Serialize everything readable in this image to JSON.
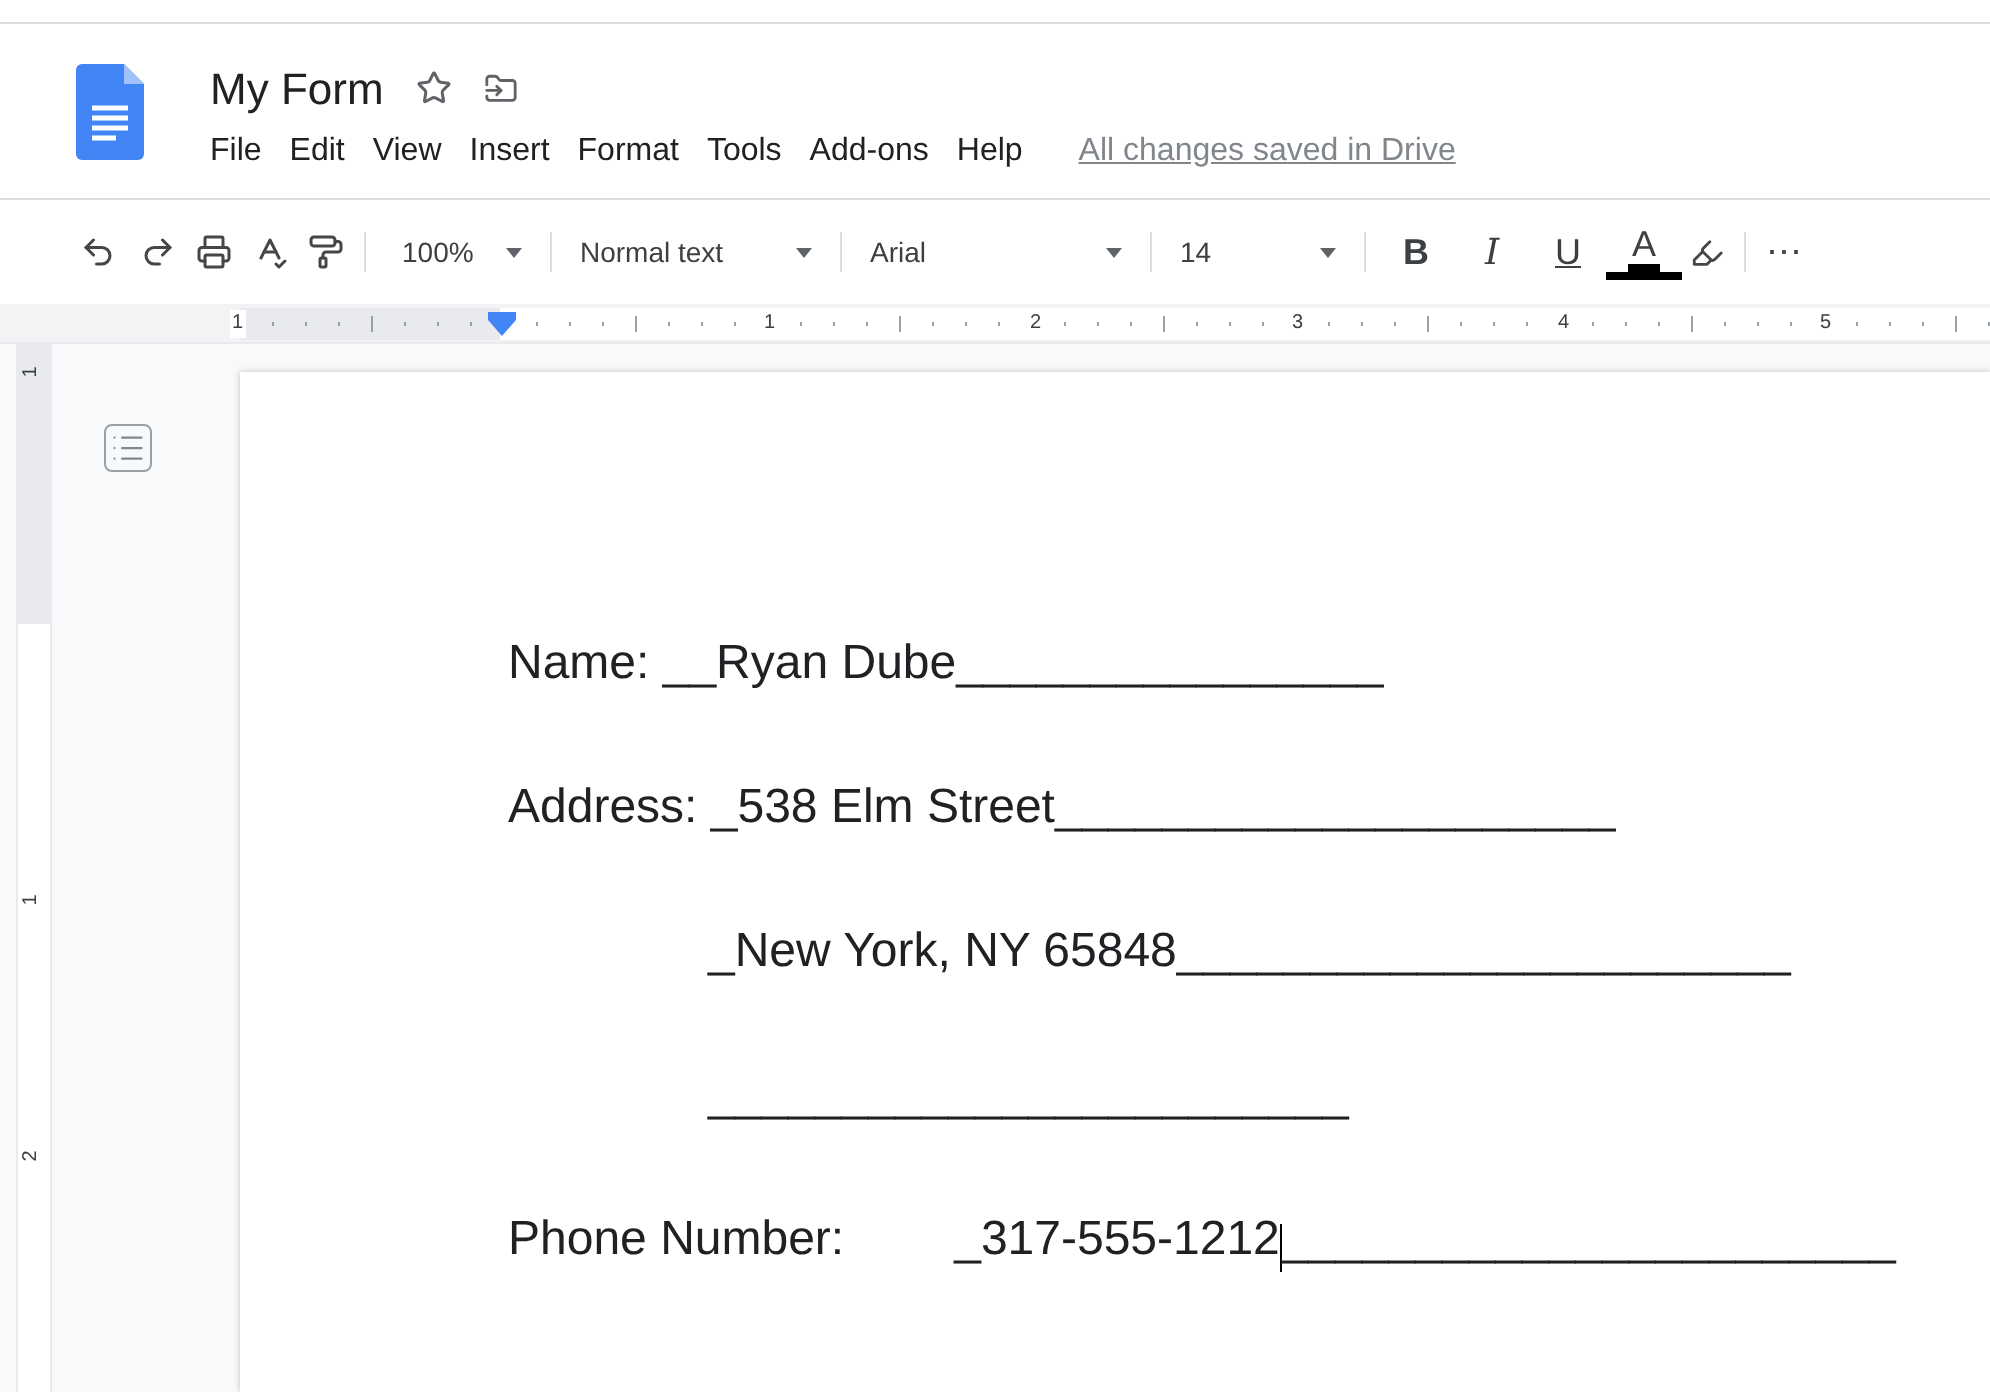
{
  "document": {
    "title": "My Form",
    "starred": false
  },
  "menu": [
    "File",
    "Edit",
    "View",
    "Insert",
    "Format",
    "Tools",
    "Add-ons",
    "Help"
  ],
  "save_status": "All changes saved in Drive",
  "toolbar": {
    "zoom": "100%",
    "style": "Normal text",
    "font": "Arial",
    "size": "14",
    "format_buttons": [
      {
        "kind": "bold",
        "label": "B"
      },
      {
        "kind": "italic",
        "label": "I"
      },
      {
        "kind": "underline",
        "label": "U"
      },
      {
        "kind": "color",
        "label": "A"
      }
    ],
    "more": "⋯"
  },
  "ruler": {
    "numbers": [
      "1",
      "1",
      "2",
      "3",
      "4",
      "5"
    ]
  },
  "vertical_ruler": {
    "numbers": [
      "1",
      "1",
      "2"
    ]
  },
  "body": [
    {
      "kind": "line",
      "text": "Name: __Ryan Dube________________"
    },
    {
      "kind": "line",
      "text": "Address: _538 Elm Street_____________________"
    },
    {
      "kind": "indented",
      "text": "_New York, NY 65848_______________________"
    },
    {
      "kind": "indented",
      "text": "________________________"
    },
    {
      "kind": "field",
      "label": "Phone Number:",
      "value": "_317-555-1212",
      "rest": "_______________________",
      "cursor": true
    }
  ]
}
